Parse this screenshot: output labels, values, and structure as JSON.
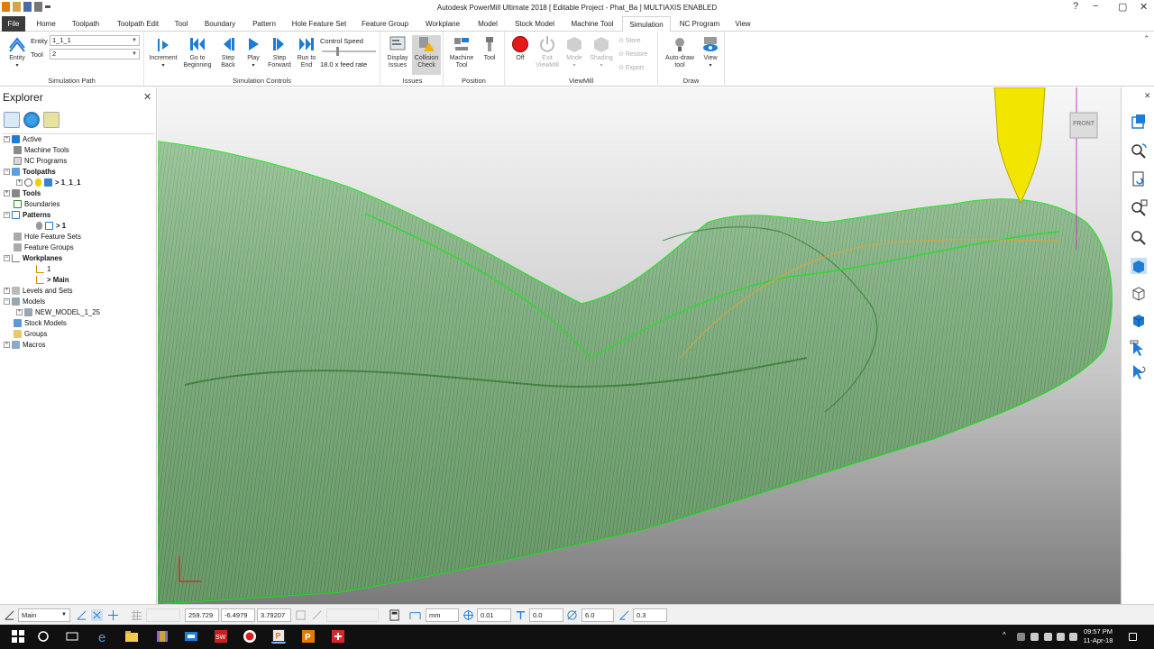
{
  "window": {
    "title": "Autodesk PowerMill Ultimate 2018   [ Editable Project - Phat_Ba ]   MULTIAXIS ENABLED"
  },
  "tabs": [
    {
      "label": "File"
    },
    {
      "label": "Home"
    },
    {
      "label": "Toolpath"
    },
    {
      "label": "Toolpath Edit"
    },
    {
      "label": "Tool"
    },
    {
      "label": "Boundary"
    },
    {
      "label": "Pattern"
    },
    {
      "label": "Hole Feature Set"
    },
    {
      "label": "Feature Group"
    },
    {
      "label": "Workplane"
    },
    {
      "label": "Model"
    },
    {
      "label": "Stock Model"
    },
    {
      "label": "Machine Tool"
    },
    {
      "label": "Simulation"
    },
    {
      "label": "NC Program"
    },
    {
      "label": "View"
    }
  ],
  "active_tab": "Simulation",
  "ribbon": {
    "simulation_path": {
      "title": "Simulation Path",
      "entity_button": "Entity",
      "entity_label": "Entity",
      "entity_value": "1_1_1",
      "tool_label": "Tool",
      "tool_value": "2"
    },
    "simulation_controls": {
      "title": "Simulation Controls",
      "increment": "Increment",
      "go_to_beginning": "Go to Beginning",
      "step_back": "Step Back",
      "play": "Play",
      "step_forward": "Step Forward",
      "run_to_end": "Run to End",
      "control_speed": "Control Speed",
      "feed_rate": "18.0 x feed rate"
    },
    "issues": {
      "title": "Issues",
      "display_issues": "Display Issues",
      "collision_check": "Collision Check"
    },
    "position": {
      "title": "Position",
      "machine_tool": "Machine Tool",
      "tool": "Tool"
    },
    "viewmill": {
      "title": "ViewMill",
      "off": "Off",
      "exit_viewmill": "Exit ViewMill",
      "mode": "Mode",
      "shading": "Shading",
      "store": "Store",
      "restore": "Restore",
      "export": "Export"
    },
    "draw": {
      "title": "Draw",
      "auto_draw_tool": "Auto-draw tool",
      "view": "View"
    }
  },
  "explorer": {
    "title": "Explorer",
    "tree": [
      {
        "label": "Active",
        "level": 0,
        "bold": false,
        "expander": "+"
      },
      {
        "label": "Machine Tools",
        "level": 0,
        "bold": false,
        "expander": ""
      },
      {
        "label": "NC Programs",
        "level": 0,
        "bold": false,
        "expander": ""
      },
      {
        "label": "Toolpaths",
        "level": 0,
        "bold": true,
        "expander": "-"
      },
      {
        "label": "> 1_1_1",
        "level": 1,
        "bold": true,
        "expander": "+"
      },
      {
        "label": "Tools",
        "level": 0,
        "bold": true,
        "expander": "+"
      },
      {
        "label": "Boundaries",
        "level": 0,
        "bold": false,
        "expander": ""
      },
      {
        "label": "Patterns",
        "level": 0,
        "bold": true,
        "expander": "-"
      },
      {
        "label": "> 1",
        "level": 1,
        "bold": true,
        "expander": ""
      },
      {
        "label": "Hole Feature Sets",
        "level": 0,
        "bold": false,
        "expander": ""
      },
      {
        "label": "Feature Groups",
        "level": 0,
        "bold": false,
        "expander": ""
      },
      {
        "label": "Workplanes",
        "level": 0,
        "bold": true,
        "expander": "-"
      },
      {
        "label": "1",
        "level": 1,
        "bold": false,
        "expander": ""
      },
      {
        "label": "> Main",
        "level": 1,
        "bold": true,
        "expander": ""
      },
      {
        "label": "Levels and Sets",
        "level": 0,
        "bold": false,
        "expander": "+"
      },
      {
        "label": "Models",
        "level": 0,
        "bold": false,
        "expander": "-"
      },
      {
        "label": "NEW_MODEL_1_25",
        "level": 1,
        "bold": false,
        "expander": "+"
      },
      {
        "label": "Stock Models",
        "level": 0,
        "bold": false,
        "expander": ""
      },
      {
        "label": "Groups",
        "level": 0,
        "bold": false,
        "expander": ""
      },
      {
        "label": "Macros",
        "level": 0,
        "bold": false,
        "expander": "+"
      }
    ]
  },
  "viewport": {
    "view_cube_label": "FRONT"
  },
  "statusbar": {
    "workplane": "Main",
    "x": "259.729",
    "y": "-6.4979",
    "z": "3.79207",
    "units": "mm",
    "tolerance": "0.01",
    "thickness": "0.0",
    "diameter": "6.0",
    "stepover": "0.3"
  },
  "taskbar": {
    "time": "09:57 PM",
    "date": "11-Apr-18"
  },
  "colors": {
    "accent_blue": "#1e7bd6",
    "toolpath_green": "#2fd92f",
    "tool_yellow": "#f2e600",
    "record_red": "#e31b1b"
  }
}
